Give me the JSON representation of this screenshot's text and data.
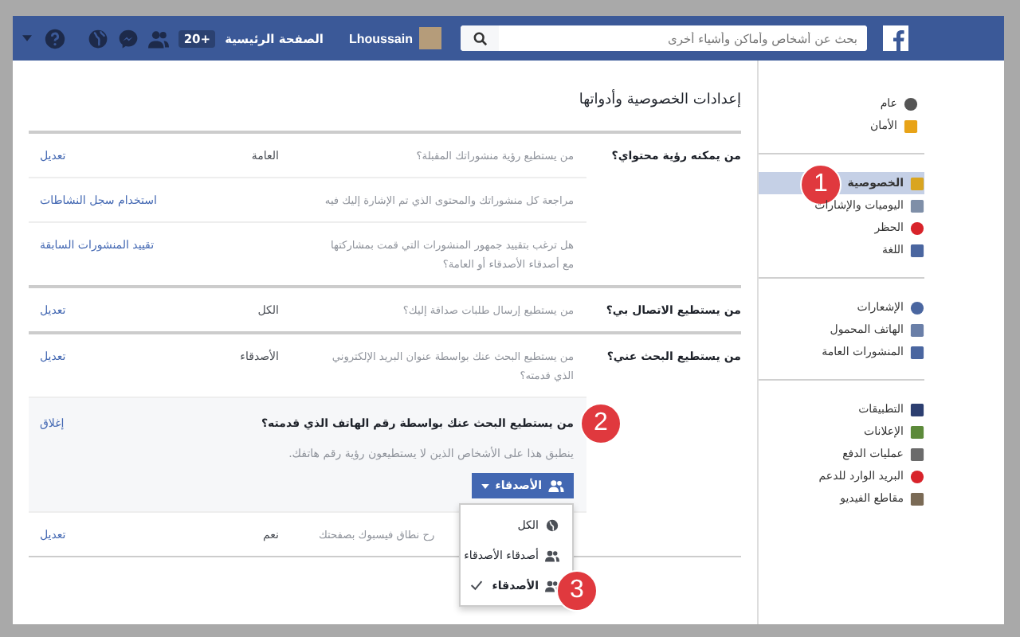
{
  "topbar": {
    "search": {
      "placeholder": "بحث عن أشخاص وأماكن وأشياء أخرى"
    },
    "user_name": "Lhoussain",
    "home_link": "الصفحة الرئيسية",
    "home_badge": "20+"
  },
  "sidebar": {
    "groups": [
      {
        "items": [
          {
            "label": "عام",
            "selected": false
          },
          {
            "label": "الأمان",
            "selected": false
          }
        ]
      },
      {
        "items": [
          {
            "label": "الخصوصية",
            "selected": true,
            "marker": "1"
          },
          {
            "label": "اليوميات والإشارات",
            "selected": false
          },
          {
            "label": "الحظر",
            "selected": false
          },
          {
            "label": "اللغة",
            "selected": false
          }
        ]
      },
      {
        "items": [
          {
            "label": "الإشعارات",
            "selected": false
          },
          {
            "label": "الهاتف المحمول",
            "selected": false
          },
          {
            "label": "المنشورات العامة",
            "selected": false
          }
        ]
      },
      {
        "items": [
          {
            "label": "التطبيقات",
            "selected": false
          },
          {
            "label": "الإعلانات",
            "selected": false
          },
          {
            "label": "عمليات الدفع",
            "selected": false
          },
          {
            "label": "البريد الوارد للدعم",
            "selected": false
          },
          {
            "label": "مقاطع الفيديو",
            "selected": false
          }
        ]
      }
    ]
  },
  "main": {
    "title": "إعدادات الخصوصية وأدواتها",
    "sections": [
      {
        "label": "من يمكنه رؤية محتواي؟",
        "rows": [
          {
            "kind": "setting",
            "description": "من يستطيع رؤية منشوراتك المقبلة؟",
            "value": "العامة",
            "action": "تعديل"
          },
          {
            "kind": "setting",
            "description": "مراجعة كل منشوراتك والمحتوى الذي تم الإشارة إليك فيه",
            "action": "استخدام سجل النشاطات"
          },
          {
            "kind": "setting",
            "description": "هل ترغب بتقييد جمهور المنشورات التي قمت بمشاركتها مع أصدقاء الأصدقاء أو العامة؟",
            "action": "تقييد المنشورات السابقة"
          }
        ]
      },
      {
        "label": "من يستطيع الاتصال بي؟",
        "rows": [
          {
            "kind": "setting",
            "description": "من يستطيع إرسال طلبات صداقة إليك؟",
            "value": "الكل",
            "action": "تعديل"
          }
        ]
      },
      {
        "label": "من يستطيع البحث عني؟",
        "rows": [
          {
            "kind": "setting",
            "description": "من يستطيع البحث عنك بواسطة عنوان البريد الإلكتروني الذي قدمته؟",
            "value": "الأصدقاء",
            "action": "تعديل"
          },
          {
            "kind": "expanded",
            "title": "من يستطيع البحث عنك بواسطة رقم الهاتف الذي قدمته؟",
            "marker": "2",
            "hint": "ينطبق هذا على الأشخاص الذين لا يستطيعون رؤية رقم هاتفك.",
            "action": "إغلاق",
            "dropdown": {
              "label": "الأصدقاء",
              "open": true,
              "options": [
                {
                  "label": "الكل",
                  "selected": false
                },
                {
                  "label": "أصدقاء الأصدقاء",
                  "selected": false
                },
                {
                  "label": "الأصدقاء",
                  "selected": true,
                  "marker": "3"
                }
              ]
            }
          },
          {
            "kind": "setting",
            "description": "رح نطاق فيسبوك بصفحتك",
            "partially_hidden": true,
            "value": "نعم",
            "action": "تعديل"
          }
        ]
      }
    ]
  }
}
